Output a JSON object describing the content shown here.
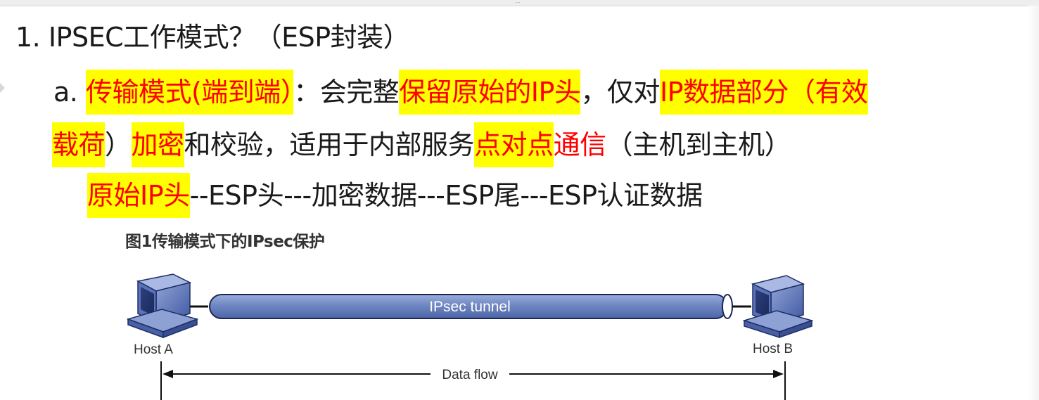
{
  "heading": {
    "text": "1. IPSEC工作模式？（ESP封装）"
  },
  "item_a": {
    "marker": "a. ",
    "part1": "传输模式(端到端）",
    "part2": "：会完整",
    "part3": "保留原始的IP头",
    "part4": "，仅对",
    "part5": "IP数据部分（有效",
    "part6": "载荷",
    "part7": "）",
    "part8": "加密",
    "part9": "和校验，适用于内部服务",
    "part10": "点对点",
    "part11": "通信",
    "part12": "（主机到主机）"
  },
  "packet": {
    "part1": "原始IP头",
    "part2": "--ESP头---加密数据---ESP尾---ESP认证数据"
  },
  "figure": {
    "title": "图1传输模式下的IPsec保护",
    "tunnel_label": "IPsec tunnel",
    "host_a": "Host A",
    "host_b": "Host B",
    "flow_label": "Data flow"
  },
  "colors": {
    "highlight": "#ffff00",
    "red_text": "#ff0000",
    "tunnel_fill": "#6f87c2"
  },
  "icons": {
    "host_a": "computer-icon",
    "host_b": "computer-icon"
  }
}
